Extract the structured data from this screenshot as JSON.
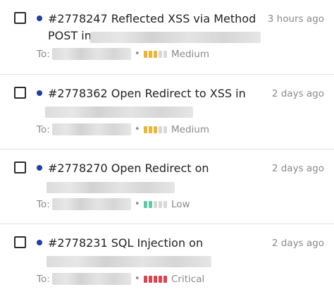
{
  "colors": {
    "unread_dot": "#1f3ea8",
    "bar_empty": "#d8d8d8",
    "medium": "#f0b431",
    "low": "#5ec9a8",
    "critical": "#e0424f"
  },
  "reports": [
    {
      "id_title": "#2778247 Reflected XSS via Method",
      "title_cont": "POST in",
      "time": "3 hours ago",
      "to_label": "To:",
      "severity": {
        "label": "Medium",
        "level": 3,
        "color": "#f0b431"
      }
    },
    {
      "id_title": "#2778362 Open Redirect to XSS in",
      "title_cont": "",
      "time": "2 days ago",
      "to_label": "To:",
      "severity": {
        "label": "Medium",
        "level": 3,
        "color": "#f0b431"
      }
    },
    {
      "id_title": "#2778270 Open Redirect on",
      "title_cont": "",
      "time": "2 days ago",
      "to_label": "To:",
      "severity": {
        "label": "Low",
        "level": 2,
        "color": "#5ec9a8"
      }
    },
    {
      "id_title": "#2778231 SQL Injection on",
      "title_cont": "",
      "time": "2 days ago",
      "to_label": "To:",
      "severity": {
        "label": "Critical",
        "level": 5,
        "color": "#e0424f"
      }
    }
  ]
}
